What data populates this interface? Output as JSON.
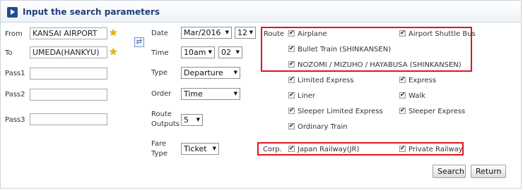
{
  "header": {
    "title": "Input the search parameters"
  },
  "labels": {
    "from": "From",
    "to": "To",
    "pass1": "Pass1",
    "pass2": "Pass2",
    "pass3": "Pass3",
    "date": "Date",
    "time": "Time",
    "type": "Type",
    "order": "Order",
    "route_outputs_1": "Route",
    "route_outputs_2": "Outputs",
    "fare_type_1": "Fare",
    "fare_type_2": "Type",
    "route": "Route",
    "corp": "Corp."
  },
  "inputs": {
    "from": "KANSAI AIRPORT",
    "to": "UMEDA(HANKYU)",
    "pass1": "",
    "pass2": "",
    "pass3": ""
  },
  "selects": {
    "month": "Mar/2016",
    "day": "12",
    "hour": "10am",
    "minute": "02",
    "type": "Departure",
    "order": "Time",
    "route_outputs": "5",
    "fare_type": "Ticket"
  },
  "route_options": [
    "Airplane",
    "Airport Shuttle Bus",
    "Bullet Train (SHINKANSEN)",
    "NOZOMI / MIZUHO / HAYABUSA (SHINKANSEN)",
    "Limited Express",
    "Express",
    "Liner",
    "Walk",
    "Sleeper Limited Express",
    "Sleeper Express",
    "Ordinary Train"
  ],
  "corp_options": [
    "Japan Railway(JR)",
    "Private Railway"
  ],
  "buttons": {
    "search": "Search",
    "return": "Return"
  },
  "icons": {
    "header": "play-icon",
    "favorite": "star-icon",
    "swap": "swap-icon"
  },
  "colors": {
    "title": "#1f3f7a",
    "highlight": "#e1141e",
    "star": "#e8b400"
  }
}
